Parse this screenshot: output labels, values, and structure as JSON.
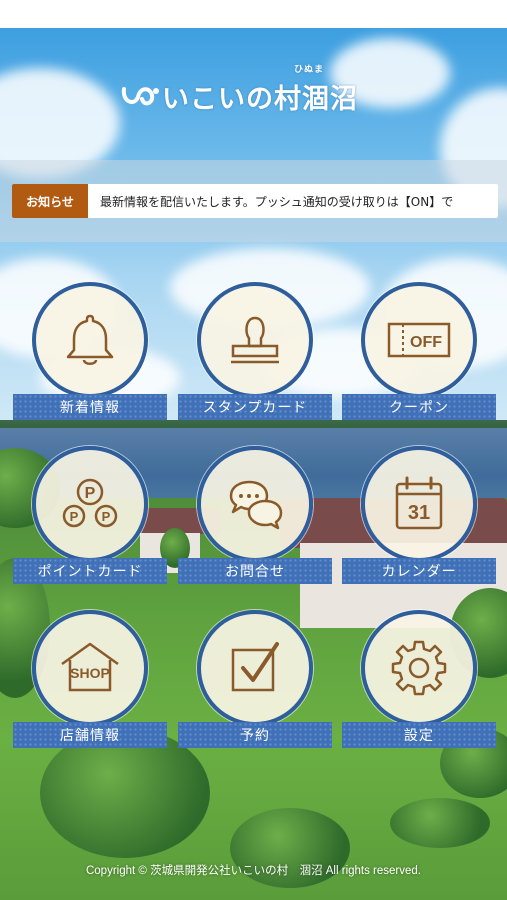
{
  "header": {
    "logo_text": "いこいの村涸沼",
    "logo_ruby": "ひぬま"
  },
  "news": {
    "tag": "お知らせ",
    "text": "最新情報を配信いたします。プッシュ通知の受け取りは【ON】で"
  },
  "menu": [
    {
      "label": "新着情報",
      "icon": "bell-icon"
    },
    {
      "label": "スタンプカード",
      "icon": "stamp-icon"
    },
    {
      "label": "クーポン",
      "icon": "coupon-icon",
      "icon_text": "OFF"
    },
    {
      "label": "ポイントカード",
      "icon": "points-icon",
      "icon_text": "P"
    },
    {
      "label": "お問合せ",
      "icon": "chat-bubbles-icon"
    },
    {
      "label": "カレンダー",
      "icon": "calendar-icon",
      "icon_text": "31"
    },
    {
      "label": "店舗情報",
      "icon": "shop-icon",
      "icon_text": "SHOP"
    },
    {
      "label": "予約",
      "icon": "checkbox-icon"
    },
    {
      "label": "設定",
      "icon": "gear-icon"
    }
  ],
  "footer": {
    "copyright": "Copyright © 茨城県開発公社いこいの村　涸沼 All rights reserved."
  },
  "colors": {
    "accent_blue": "#3f70b8",
    "circle_border": "#2f5e9c",
    "icon_brown": "#8a5a2b",
    "news_tag": "#b15a12"
  }
}
